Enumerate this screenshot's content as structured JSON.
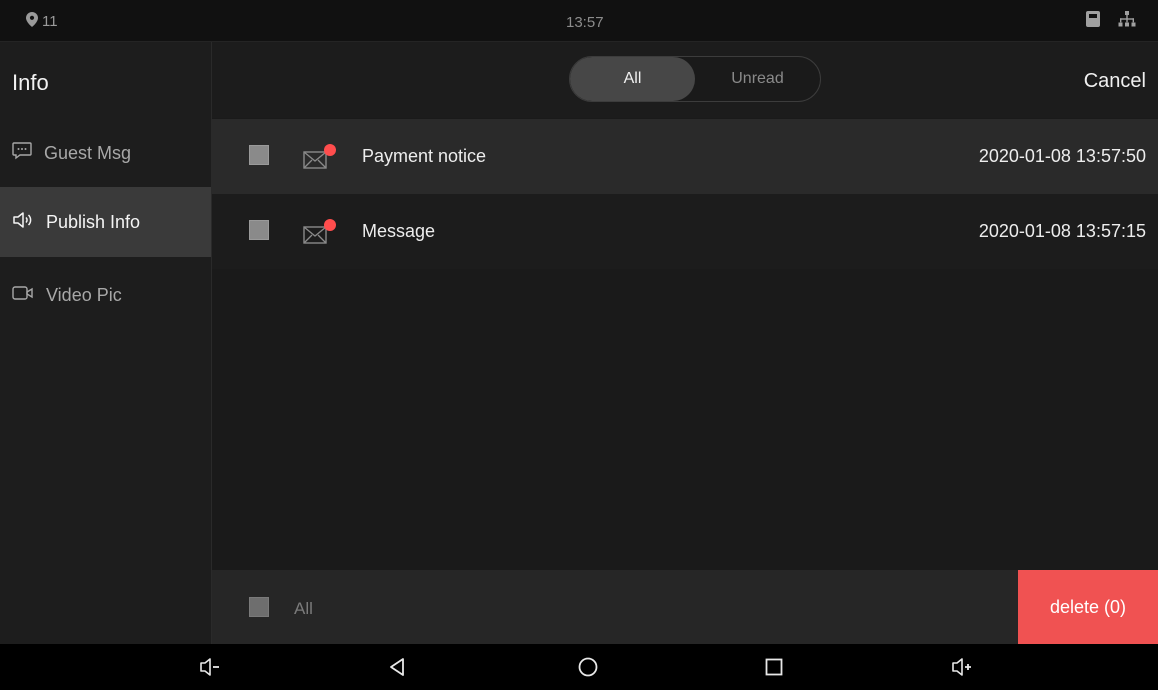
{
  "status_bar": {
    "location_count": "11",
    "time": "13:57",
    "icons": [
      "location-pin-icon",
      "sd-card-icon",
      "network-icon"
    ]
  },
  "sidebar": {
    "title": "Info",
    "items": [
      {
        "label": "Guest Msg",
        "icon": "message-icon",
        "selected": false
      },
      {
        "label": "Publish Info",
        "icon": "speaker-icon",
        "selected": true
      },
      {
        "label": "Video Pic",
        "icon": "video-icon",
        "selected": false
      }
    ]
  },
  "header": {
    "filter_tabs": [
      {
        "label": "All",
        "active": true
      },
      {
        "label": "Unread",
        "active": false
      }
    ],
    "cancel_label": "Cancel"
  },
  "messages": [
    {
      "title": "Payment notice",
      "datetime": "2020-01-08 13:57:50",
      "unread": true,
      "checked": false,
      "icon": "envelope-icon"
    },
    {
      "title": "Message",
      "datetime": "2020-01-08 13:57:15",
      "unread": true,
      "checked": false,
      "icon": "envelope-icon"
    }
  ],
  "footer": {
    "select_all_label": "All",
    "delete_label": "delete (0)"
  },
  "nav_bar": {
    "icons": [
      "volume-down-icon",
      "back-icon",
      "home-icon",
      "recents-icon",
      "volume-up-icon"
    ]
  },
  "colors": {
    "accent_delete": "#f05252",
    "unread_dot": "#ff4d4d",
    "selected_sidebar": "#3a3a3a"
  }
}
